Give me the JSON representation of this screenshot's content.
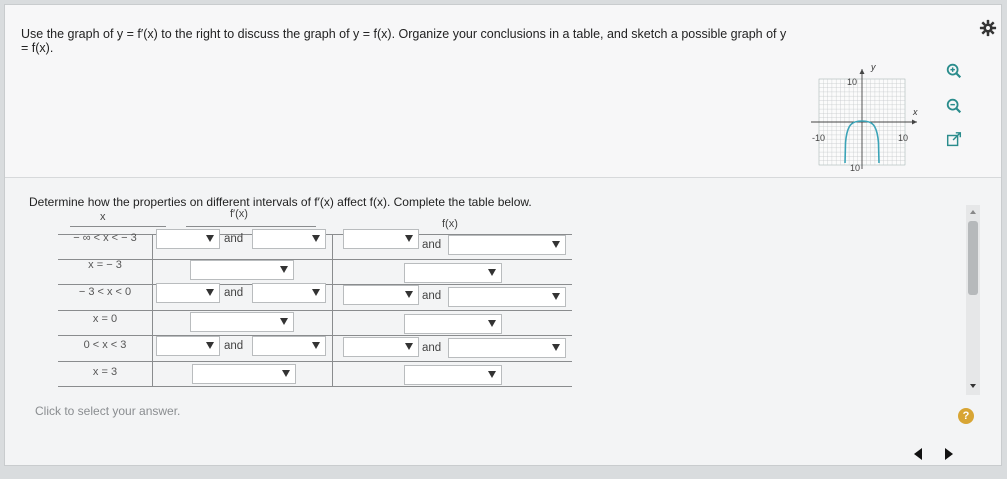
{
  "question": {
    "text": "Use the graph of y = f′(x) to the right to discuss the graph of y = f(x). Organize your conclusions in a table, and sketch a possible graph of y = f(x)."
  },
  "graph": {
    "y_label": "y",
    "x_label": "x",
    "y_top_tick": "10",
    "y_bottom_tick": "10",
    "x_left_tick": "-10",
    "x_right_tick": "10"
  },
  "instructions": "Determine how the properties on different intervals of f′(x) affect f(x). Complete the table below.",
  "table": {
    "headers": {
      "x": "x",
      "fprime": "f′(x)",
      "f": "f(x)"
    },
    "rows": [
      {
        "label": "− ∞ < x < − 3",
        "and_fprime": "and",
        "and_f": "and"
      },
      {
        "label": "x = − 3"
      },
      {
        "label": "− 3 < x < 0",
        "and_fprime": "and",
        "and_f": "and"
      },
      {
        "label": "x = 0"
      },
      {
        "label": "0 < x < 3",
        "and_fprime": "and",
        "and_f": "and"
      },
      {
        "label": "x = 3"
      }
    ]
  },
  "footer": {
    "click_hint": "Click to select your answer.",
    "help": "?"
  },
  "icons": {
    "gear": "gear-icon",
    "zoom_in": "zoom-in-icon",
    "zoom_out": "zoom-out-icon",
    "popout": "popout-icon"
  },
  "colors": {
    "accent_teal": "#2a8c8c",
    "help_gold": "#d8a534",
    "graph_curve": "#3aa3b7"
  }
}
